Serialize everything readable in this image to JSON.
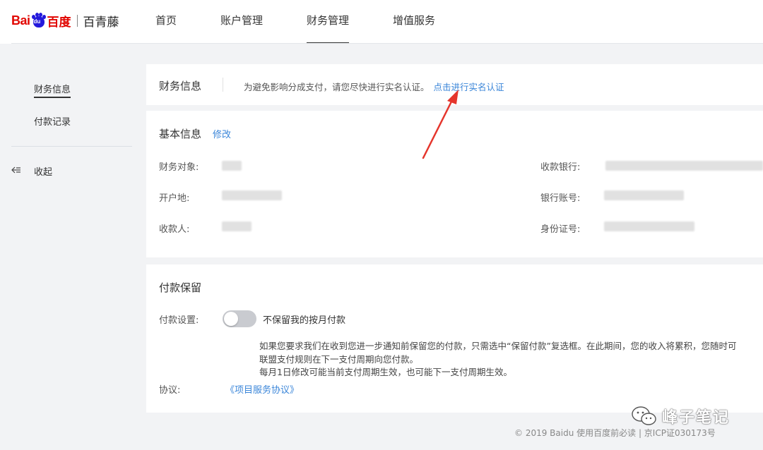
{
  "brand": {
    "logo_bai": "Bai",
    "logo_du": "du",
    "logo_cn": "百度",
    "product": "百青藤"
  },
  "nav": {
    "items": [
      "首页",
      "账户管理",
      "财务管理",
      "增值服务"
    ],
    "active": "财务管理"
  },
  "sidebar": {
    "items": [
      "财务信息",
      "付款记录"
    ],
    "active": "财务信息",
    "collapse_label": "收起"
  },
  "finance_info": {
    "title": "财务信息",
    "notice": "为避免影响分成支付，请您尽快进行实名认证。",
    "verify_link": "点击进行实名认证"
  },
  "basic_info": {
    "title": "基本信息",
    "edit_label": "修改",
    "fields_left": [
      "财务对象:",
      "开户地:",
      "收款人:"
    ],
    "fields_right": [
      "收款银行:",
      "银行账号:",
      "身份证号:"
    ]
  },
  "payment_hold": {
    "title": "付款保留",
    "setting_label": "付款设置:",
    "toggle_label": "不保留我的按月付款",
    "toggle_on": false,
    "desc_line1": "如果您要求我们在收到您进一步通知前保留您的付款，只需选中“保留付款”复选框。在此期间，您的收入将累积，您随时可",
    "desc_line2": "联盟支付规则在下一支付周期向您付款。",
    "desc_line3": "每月1日修改可能当前支付周期生效，也可能下一支付周期生效。",
    "agreement_label": "协议:",
    "agreement_link": "《项目服务协议》"
  },
  "footer": {
    "text": "© 2019 Baidu  使用百度前必读 | 京ICP证030173号"
  },
  "watermark": {
    "text": "峰子笔记"
  },
  "colors": {
    "brand_red": "#e10601",
    "brand_blue": "#2319dc",
    "link": "#3b86d9",
    "arrow": "#e5352c"
  }
}
